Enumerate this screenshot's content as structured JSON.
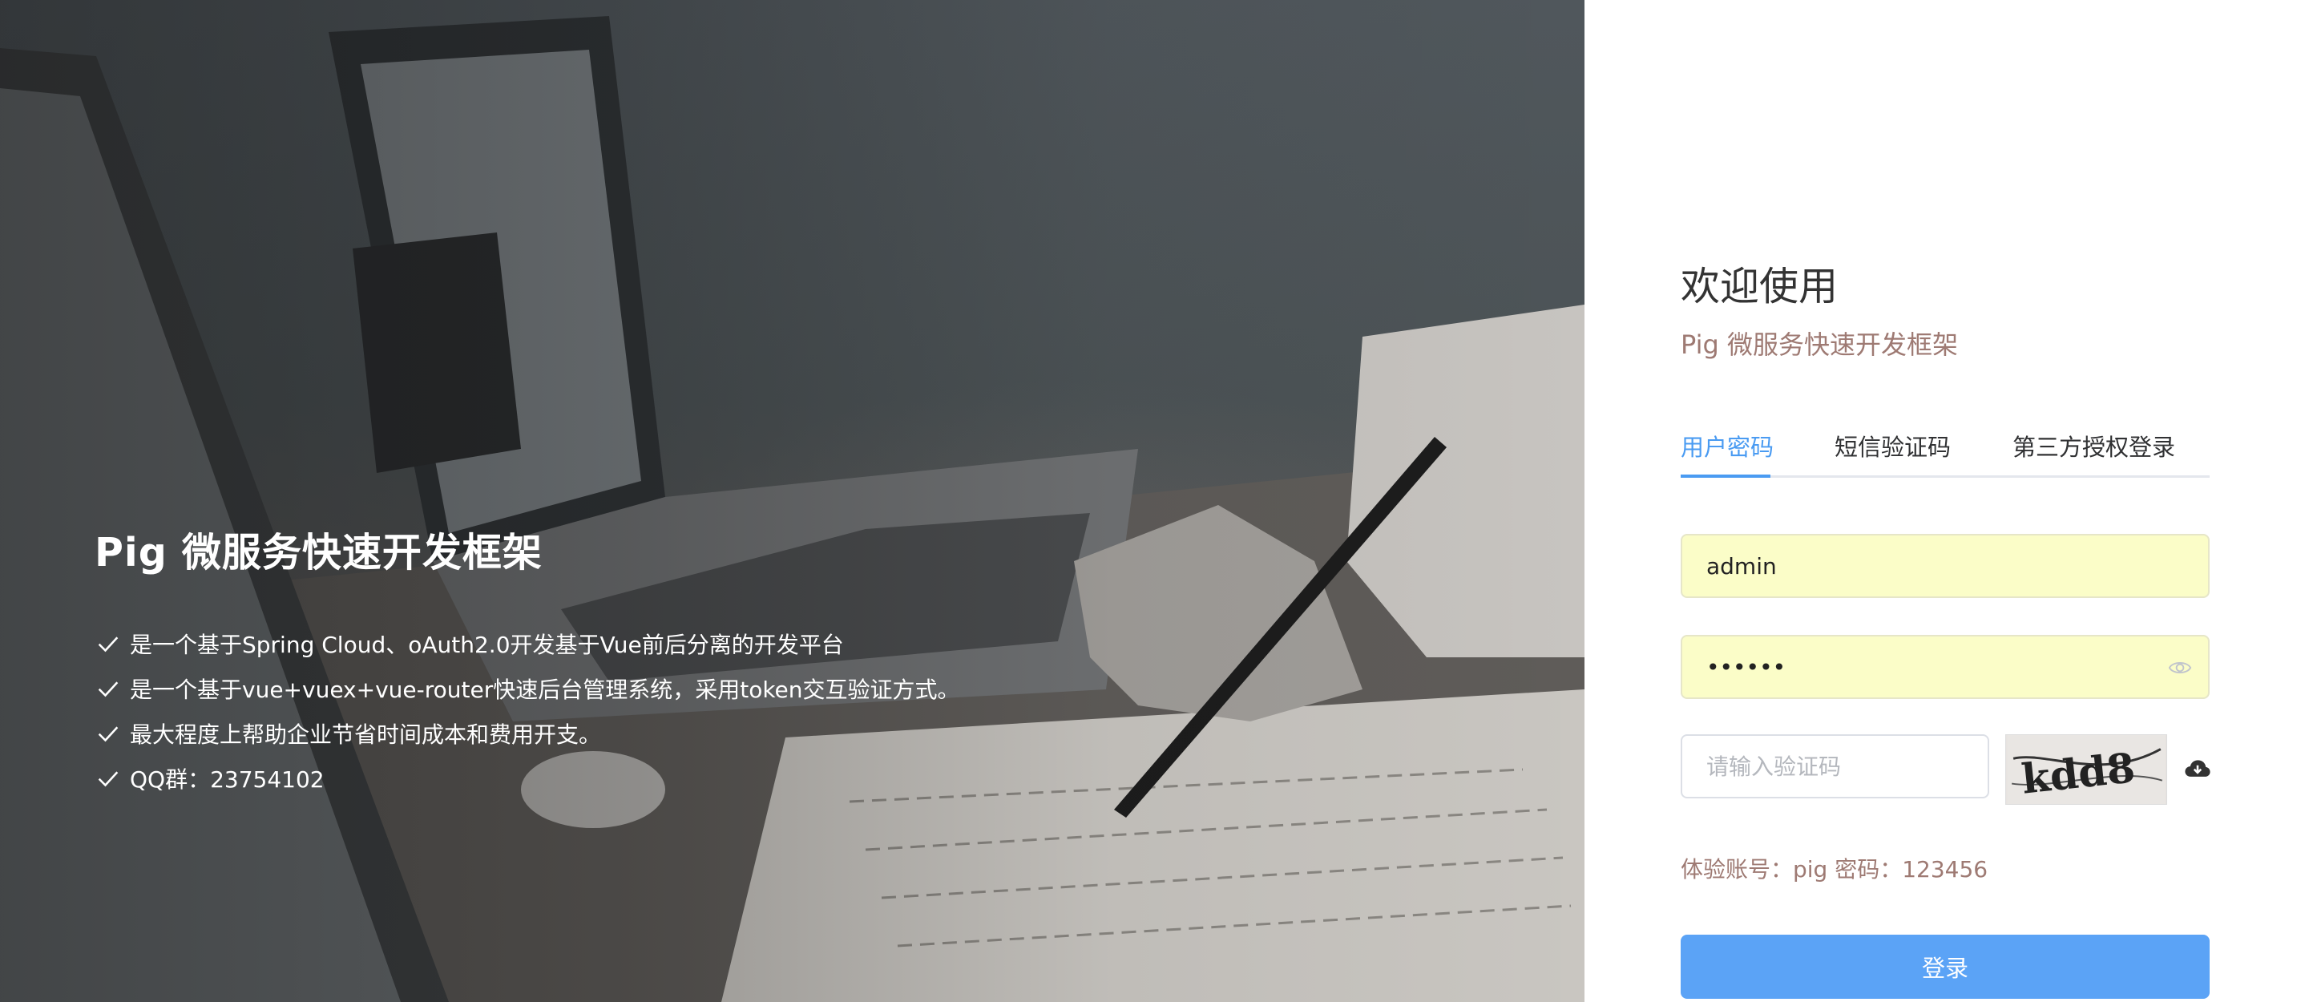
{
  "hero": {
    "title": "Pig 微服务快速开发框架",
    "features": [
      "是一个基于Spring Cloud、oAuth2.0开发基于Vue前后分离的开发平台",
      "是一个基于vue+vuex+vue-router快速后台管理系统，采用token交互验证方式。",
      "最大程度上帮助企业节省时间成本和费用开支。",
      "QQ群：23754102"
    ],
    "feature_icon": "check-icon"
  },
  "login": {
    "welcome": "欢迎使用",
    "subtitle": "Pig 微服务快速开发框架",
    "tabs": [
      "用户密码",
      "短信验证码",
      "第三方授权登录"
    ],
    "active_tab": "用户密码",
    "username_value": "admin",
    "password_value": "123456",
    "captcha_placeholder": "请输入验证码",
    "captcha_text": "kdd8",
    "trial_info": "体验账号：pig 密码：123456",
    "submit_label": "登录"
  },
  "colors": {
    "accent": "#4a9bf2",
    "button": "#5ba3f6",
    "subtitle": "#9e7a73",
    "autofill": "#fbfdc8"
  }
}
